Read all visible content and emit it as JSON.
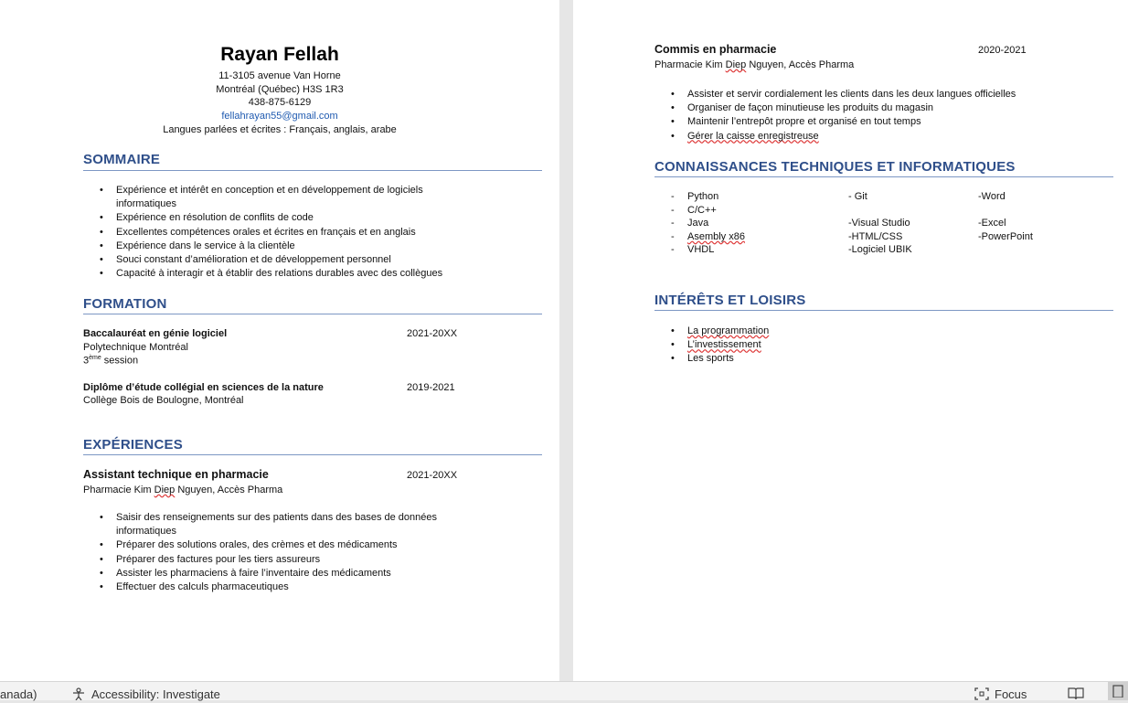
{
  "header": {
    "name": "Rayan Fellah",
    "address1": "11-3105 avenue Van Horne",
    "address2": "Montréal (Québec) H3S 1R3",
    "phone": "438-875-6129",
    "email": "fellahrayan55@gmail.com",
    "languages": "Langues parlées et écrites : Français, anglais, arabe"
  },
  "sommaire": {
    "title": "SOMMAIRE",
    "items": [
      "Expérience et intérêt en conception et en développement de logiciels",
      "informatiques",
      "Expérience en résolution de conflits de code",
      "Excellentes compétences orales et écrites en français et en anglais",
      "Expérience dans le service à la clientèle",
      "Souci constant d’amélioration et de développement personnel",
      "Capacité à interagir et à établir des relations durables avec des collègues"
    ]
  },
  "formation": {
    "title": "FORMATION",
    "entries": [
      {
        "degree": "Baccalauréat en génie logiciel",
        "date": "2021-20XX",
        "school": "Polytechnique Montréal",
        "session_num": "3",
        "session_sup": "ème",
        "session_word": " session"
      },
      {
        "degree": "Diplôme d’étude collégial en sciences de la nature",
        "date": "2019-2021",
        "school": "Collège Bois de Boulogne, Montréal"
      }
    ]
  },
  "experiences": {
    "title": "EXPÉRIENCES",
    "job1": {
      "title": "Assistant technique en pharmacie",
      "date": "2021-20XX",
      "employer_a": "Pharmacie Kim ",
      "employer_b": "Diep",
      "employer_c": " Nguyen, Accès Pharma",
      "items": [
        "Saisir des renseignements sur des patients dans des bases de données",
        "informatiques",
        "Préparer des solutions orales, des crèmes et des médicaments",
        "Préparer des factures pour les tiers assureurs",
        "Assister les pharmaciens à faire l’inventaire des médicaments",
        "Effectuer des calculs pharmaceutiques"
      ]
    },
    "job2": {
      "title": "Commis en pharmacie",
      "date": "2020-2021",
      "employer_a": "Pharmacie Kim ",
      "employer_b": "Diep",
      "employer_c": " Nguyen, Accès Pharma",
      "items": [
        "Assister et servir cordialement les clients dans les deux langues officielles",
        "Organiser de façon minutieuse les produits du magasin",
        "Maintenir l’entrepôt propre et organisé en tout temps",
        "Gérer la caisse enregistreuse"
      ]
    }
  },
  "connaissances": {
    "title": "CONNAISSANCES TECHNIQUES ET INFORMATIQUES",
    "col1": [
      "Python",
      "C/C++",
      "Java",
      "Asembly x86",
      "VHDL"
    ],
    "col2": [
      "- Git",
      "-Visual Studio",
      "-HTML/CSS",
      "-Logiciel UBIK"
    ],
    "col3": [
      "-Word",
      "-Excel",
      "-PowerPoint"
    ]
  },
  "interets": {
    "title": "INTÉRÊTS ET LOISIRS",
    "items": [
      "La programmation",
      "L’investissement",
      "Les sports"
    ]
  },
  "statusbar": {
    "language": "anada)",
    "accessibility": "Accessibility: Investigate",
    "focus": "Focus"
  }
}
